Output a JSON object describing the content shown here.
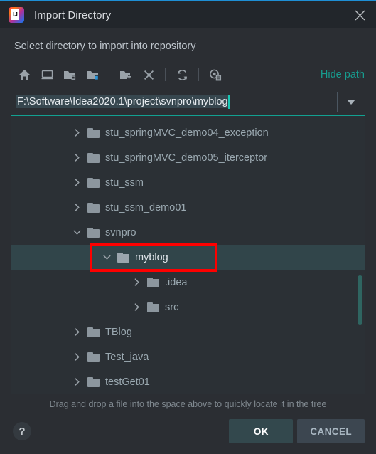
{
  "window": {
    "title": "Import Directory",
    "app_icon": "intellij-idea-icon",
    "icon_label": "IJ",
    "close_icon": "close-icon",
    "accent_color": "#1e8fd5"
  },
  "subtitle": "Select directory to import into repository",
  "toolbar": {
    "buttons": [
      {
        "name": "home-icon",
        "tooltip": "Home"
      },
      {
        "name": "desktop-icon",
        "tooltip": "Desktop"
      },
      {
        "name": "project-folder-icon",
        "tooltip": "Project Directory"
      },
      {
        "name": "module-folder-icon",
        "tooltip": "Module Directory"
      },
      {
        "name": "new-folder-icon",
        "tooltip": "New Folder"
      },
      {
        "name": "delete-icon",
        "tooltip": "Delete"
      },
      {
        "name": "refresh-icon",
        "tooltip": "Refresh"
      },
      {
        "name": "show-hidden-icon",
        "tooltip": "Show Hidden Files"
      }
    ],
    "hide_path_label": "Hide path",
    "hide_path_color": "#179c8f"
  },
  "path_field": {
    "value": "F:\\Software\\Idea2020.1\\project\\svnpro\\myblog",
    "placeholder": "",
    "dropdown_icon": "chevron-down-icon",
    "caret_color": "#19c8b5",
    "underline_color": "#12a191"
  },
  "tree": {
    "rows": [
      {
        "label": "stu_springMVC_demo04_exception",
        "indent": 1,
        "expanded": false,
        "selected": false,
        "arrow": "chevron-right-icon"
      },
      {
        "label": "stu_springMVC_demo05_iterceptor",
        "indent": 1,
        "expanded": false,
        "selected": false,
        "arrow": "chevron-right-icon"
      },
      {
        "label": "stu_ssm",
        "indent": 1,
        "expanded": false,
        "selected": false,
        "arrow": "chevron-right-icon"
      },
      {
        "label": "stu_ssm_demo01",
        "indent": 1,
        "expanded": false,
        "selected": false,
        "arrow": "chevron-right-icon"
      },
      {
        "label": "svnpro",
        "indent": 1,
        "expanded": true,
        "selected": false,
        "arrow": "chevron-down-icon"
      },
      {
        "label": "myblog",
        "indent": 2,
        "expanded": true,
        "selected": true,
        "arrow": "chevron-down-icon"
      },
      {
        "label": ".idea",
        "indent": 3,
        "expanded": false,
        "selected": false,
        "arrow": "chevron-right-icon"
      },
      {
        "label": "src",
        "indent": 3,
        "expanded": false,
        "selected": false,
        "arrow": "chevron-right-icon"
      },
      {
        "label": "TBlog",
        "indent": 1,
        "expanded": false,
        "selected": false,
        "arrow": "chevron-right-icon"
      },
      {
        "label": "Test_java",
        "indent": 1,
        "expanded": false,
        "selected": false,
        "arrow": "chevron-right-icon"
      },
      {
        "label": "testGet01",
        "indent": 1,
        "expanded": false,
        "selected": false,
        "arrow": "chevron-right-icon"
      }
    ],
    "selected_row_color": "#31454a",
    "scrollbar_color": "#2f6561",
    "annotation_color": "#fe0000"
  },
  "hint": "Drag and drop a file into the space above to quickly locate it in the tree",
  "footer": {
    "help_label": "?",
    "ok_label": "OK",
    "cancel_label": "CANCEL"
  }
}
